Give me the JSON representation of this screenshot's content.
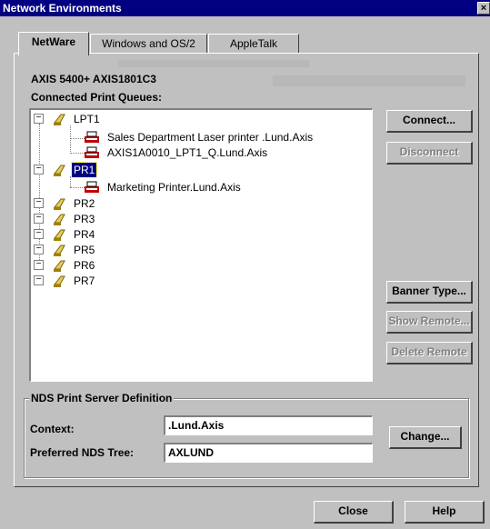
{
  "window": {
    "title": "Network Environments",
    "close_glyph": "×"
  },
  "tabs": [
    {
      "label": "NetWare",
      "active": true
    },
    {
      "label": "Windows and OS/2",
      "active": false
    },
    {
      "label": "AppleTalk",
      "active": false
    }
  ],
  "device_name": "AXIS 5400+ AXIS1801C3",
  "queues_heading": "Connected Print Queues:",
  "tree": {
    "nodes": [
      {
        "label": "LPT1",
        "type": "port",
        "expander": "−",
        "children": [
          {
            "label": "Sales Department Laser printer .Lund.Axis",
            "type": "printer"
          },
          {
            "label": "AXIS1A0010_LPT1_Q.Lund.Axis",
            "type": "printer"
          }
        ]
      },
      {
        "label": "PR1",
        "type": "port",
        "expander": "−",
        "selected": true,
        "children": [
          {
            "label": "Marketing Printer.Lund.Axis",
            "type": "printer"
          }
        ]
      },
      {
        "label": "PR2",
        "type": "port",
        "expander": "−"
      },
      {
        "label": "PR3",
        "type": "port",
        "expander": "−"
      },
      {
        "label": "PR4",
        "type": "port",
        "expander": "−"
      },
      {
        "label": "PR5",
        "type": "port",
        "expander": "−"
      },
      {
        "label": "PR6",
        "type": "port",
        "expander": "−"
      },
      {
        "label": "PR7",
        "type": "port",
        "expander": "−"
      }
    ]
  },
  "buttons": {
    "connect": {
      "label": "Connect...",
      "enabled": true
    },
    "disconnect": {
      "label": "Disconnect",
      "enabled": false
    },
    "banner_type": {
      "label": "Banner Type...",
      "enabled": true
    },
    "show_remote": {
      "label": "Show Remote...",
      "enabled": false
    },
    "delete_remote": {
      "label": "Delete Remote",
      "enabled": false
    },
    "change": {
      "label": "Change...",
      "enabled": true
    },
    "close": {
      "label": "Close",
      "enabled": true
    },
    "help": {
      "label": "Help",
      "enabled": true
    }
  },
  "nds": {
    "group_title": "NDS Print Server Definition",
    "context_label": "Context:",
    "context_value": ".Lund.Axis",
    "tree_label": "Preferred NDS Tree:",
    "tree_value": "AXLUND"
  },
  "colors": {
    "face": "#c0c0c0",
    "titlebar": "#000080",
    "selection": "#000080",
    "printer_icon": "#c00000",
    "port_icon": "#c0a000"
  }
}
